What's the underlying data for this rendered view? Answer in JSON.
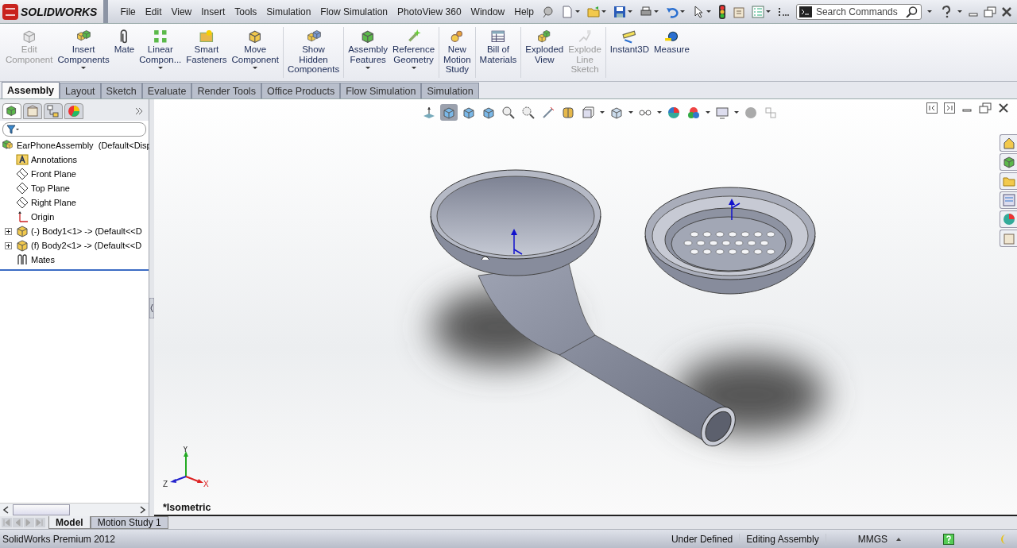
{
  "app": {
    "logo": "SOLIDWORKS"
  },
  "menu": [
    "File",
    "Edit",
    "View",
    "Insert",
    "Tools",
    "Simulation",
    "Flow Simulation",
    "PhotoView 360",
    "Window",
    "Help"
  ],
  "search": {
    "placeholder": "Search Commands"
  },
  "ribbon": [
    {
      "label": "Edit\nComponent",
      "disabled": true,
      "dropdown": false
    },
    {
      "label": "Insert\nComponents",
      "disabled": false,
      "dropdown": true
    },
    {
      "label": "Mate",
      "disabled": false,
      "dropdown": false
    },
    {
      "label": "Linear\nCompon...",
      "disabled": false,
      "dropdown": true
    },
    {
      "label": "Smart\nFasteners",
      "disabled": false,
      "dropdown": false
    },
    {
      "label": "Move\nComponent",
      "disabled": false,
      "dropdown": true
    },
    {
      "label": "Show\nHidden\nComponents",
      "disabled": false,
      "dropdown": false
    },
    {
      "label": "Assembly\nFeatures",
      "disabled": false,
      "dropdown": true
    },
    {
      "label": "Reference\nGeometry",
      "disabled": false,
      "dropdown": true
    },
    {
      "label": "New\nMotion\nStudy",
      "disabled": false,
      "dropdown": false
    },
    {
      "label": "Bill of\nMaterials",
      "disabled": false,
      "dropdown": false
    },
    {
      "label": "Exploded\nView",
      "disabled": false,
      "dropdown": false
    },
    {
      "label": "Explode\nLine\nSketch",
      "disabled": true,
      "dropdown": false
    },
    {
      "label": "Instant3D",
      "disabled": false,
      "dropdown": false
    },
    {
      "label": "Measure",
      "disabled": false,
      "dropdown": false
    }
  ],
  "tabs": [
    {
      "label": "Assembly",
      "selected": true
    },
    {
      "label": "Layout",
      "selected": false
    },
    {
      "label": "Sketch",
      "selected": false
    },
    {
      "label": "Evaluate",
      "selected": false
    },
    {
      "label": "Render Tools",
      "selected": false
    },
    {
      "label": "Office Products",
      "selected": false
    },
    {
      "label": "Flow Simulation",
      "selected": false
    },
    {
      "label": "Simulation",
      "selected": false
    }
  ],
  "panel_tabs": [
    {
      "selected": true
    },
    {
      "selected": false
    },
    {
      "selected": false
    },
    {
      "selected": false
    }
  ],
  "tree": {
    "root": {
      "label": "EarPhoneAssembly  (Default<Disp",
      "children": [
        {
          "kind": "annotations",
          "label": "Annotations"
        },
        {
          "kind": "plane",
          "label": "Front Plane"
        },
        {
          "kind": "plane",
          "label": "Top Plane"
        },
        {
          "kind": "plane",
          "label": "Right Plane"
        },
        {
          "kind": "origin",
          "label": "Origin"
        },
        {
          "kind": "part",
          "label": "(-) Body1<1> -> (Default<<D",
          "expanded": false
        },
        {
          "kind": "part",
          "label": "(f) Body2<1> -> (Default<<D",
          "expanded": false
        },
        {
          "kind": "mates",
          "label": "Mates"
        }
      ]
    }
  },
  "view_toolbar": [
    {
      "selected": false
    },
    {
      "selected": true
    },
    {
      "selected": false
    },
    {
      "selected": false
    },
    {
      "selected": false
    },
    {
      "selected": false
    },
    {
      "selected": false
    },
    {
      "selected": false
    },
    {
      "selected": false
    },
    {
      "selected": false
    },
    {
      "selected": false
    },
    {
      "selected": false
    },
    {
      "selected": false
    },
    {
      "selected": false
    },
    {
      "selected": false
    },
    {
      "selected": false
    }
  ],
  "viewport": {
    "view_label": "*Isometric",
    "triad": {
      "x": "X",
      "y": "Y",
      "z": "Z"
    }
  },
  "bottom_tabs": [
    {
      "label": "Model",
      "selected": true
    },
    {
      "label": "Motion Study 1",
      "selected": false
    }
  ],
  "status_bar": {
    "product": "SolidWorks Premium 2012",
    "state": "Under Defined",
    "mode": "Editing Assembly",
    "units": "MMGS"
  }
}
